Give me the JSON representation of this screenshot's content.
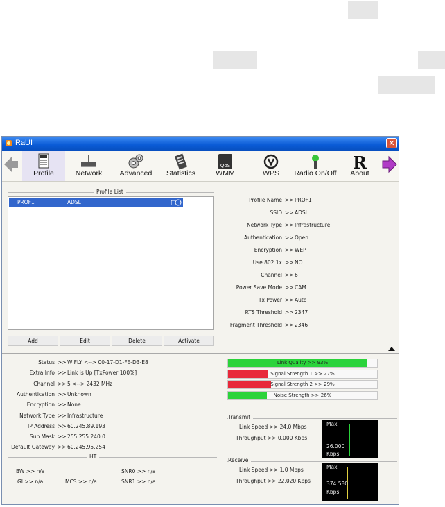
{
  "window": {
    "title": "RaUI",
    "close_glyph": "✕"
  },
  "toolbar": {
    "items": [
      {
        "label": "Profile",
        "icon": "profile-icon"
      },
      {
        "label": "Network",
        "icon": "network-icon"
      },
      {
        "label": "Advanced",
        "icon": "advanced-icon"
      },
      {
        "label": "Statistics",
        "icon": "statistics-icon"
      },
      {
        "label": "WMM",
        "icon": "wmm-icon"
      },
      {
        "label": "WPS",
        "icon": "wps-icon"
      },
      {
        "label": "Radio On/Off",
        "icon": "radio-icon"
      },
      {
        "label": "About",
        "icon": "about-icon"
      }
    ]
  },
  "profile_list": {
    "title": "Profile List",
    "rows": [
      {
        "name": "PROF1",
        "ssid": "ADSL"
      }
    ],
    "buttons": {
      "add": "Add",
      "edit": "Edit",
      "delete": "Delete",
      "activate": "Activate"
    }
  },
  "profile_detail": [
    {
      "label": "Profile Name",
      "value": "PROF1"
    },
    {
      "label": "SSID",
      "value": "ADSL"
    },
    {
      "label": "Network Type",
      "value": "Infrastructure"
    },
    {
      "label": "Authentication",
      "value": "Open"
    },
    {
      "label": "Encryption",
      "value": "WEP"
    },
    {
      "label": "Use 802.1x",
      "value": "NO"
    },
    {
      "label": "Channel",
      "value": "6"
    },
    {
      "label": "Power Save Mode",
      "value": "CAM"
    },
    {
      "label": "Tx Power",
      "value": "Auto"
    },
    {
      "label": "RTS Threshold",
      "value": "2347"
    },
    {
      "label": "Fragment Threshold",
      "value": "2346"
    }
  ],
  "separator": ">>",
  "status": [
    {
      "label": "Status",
      "value": "WIFLY <--> 00-17-D1-FE-D3-E8"
    },
    {
      "label": "Extra Info",
      "value": "Link is Up [TxPower:100%]"
    },
    {
      "label": "Channel",
      "value": "5 <--> 2432 MHz"
    },
    {
      "label": "Authentication",
      "value": "Unknown"
    },
    {
      "label": "Encryption",
      "value": "None"
    },
    {
      "label": "Network Type",
      "value": "Infrastructure"
    },
    {
      "label": "IP Address",
      "value": "60.245.89.193"
    },
    {
      "label": "Sub Mask",
      "value": "255.255.240.0"
    },
    {
      "label": "Default Gateway",
      "value": "60.245.95.254"
    }
  ],
  "ht": {
    "title": "HT",
    "bw": "BW >> n/a",
    "gi": "GI >> n/a",
    "mcs": "MCS >> n/a",
    "snr0": "SNR0 >> n/a",
    "snr1": "SNR1 >> n/a"
  },
  "signal": [
    {
      "text": "Link Quality >> 93%",
      "percent": 93,
      "color": "#2bd33b"
    },
    {
      "text": "Signal Strength 1 >> 27%",
      "percent": 27,
      "color": "#e8283a"
    },
    {
      "text": "Signal Strength 2 >> 29%",
      "percent": 29,
      "color": "#e8283a"
    },
    {
      "text": "Noise Strength >> 26%",
      "percent": 26,
      "color": "#2bd33b"
    }
  ],
  "transmit": {
    "title": "Transmit",
    "link_speed": "Link Speed >> 24.0 Mbps",
    "throughput": "Throughput >> 0.000 Kbps",
    "graph_max": "Max",
    "graph_value": "26.000",
    "graph_unit": "Kbps"
  },
  "receive": {
    "title": "Receive",
    "link_speed": "Link Speed >> 1.0 Mbps",
    "throughput": "Throughput >> 22.020 Kbps",
    "graph_max": "Max",
    "graph_value": "374.580",
    "graph_unit": "Kbps"
  }
}
